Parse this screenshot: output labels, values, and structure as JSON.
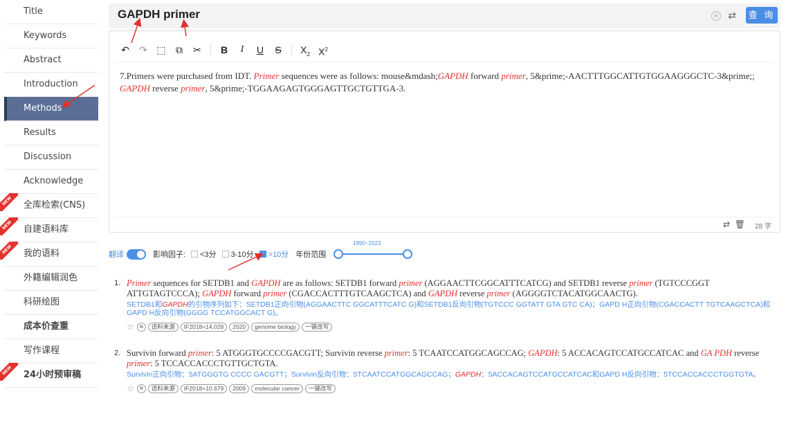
{
  "sidebar": {
    "items": [
      {
        "label": "Title",
        "active": false,
        "bold": false,
        "new": false
      },
      {
        "label": "Keywords",
        "active": false,
        "bold": false,
        "new": false
      },
      {
        "label": "Abstract",
        "active": false,
        "bold": false,
        "new": false
      },
      {
        "label": "Introduction",
        "active": false,
        "bold": false,
        "new": false
      },
      {
        "label": "Methods",
        "active": true,
        "bold": false,
        "new": false
      },
      {
        "label": "Results",
        "active": false,
        "bold": false,
        "new": false
      },
      {
        "label": "Discussion",
        "active": false,
        "bold": false,
        "new": false
      },
      {
        "label": "Acknowledge",
        "active": false,
        "bold": false,
        "new": false
      },
      {
        "label": "全库检索(CNS)",
        "active": false,
        "bold": false,
        "new": true
      },
      {
        "label": "自建语料库",
        "active": false,
        "bold": false,
        "new": true
      },
      {
        "label": "我的语料",
        "active": false,
        "bold": false,
        "new": true
      },
      {
        "label": "外籍编辑润色",
        "active": false,
        "bold": false,
        "new": false
      },
      {
        "label": "科研绘图",
        "active": false,
        "bold": false,
        "new": false
      },
      {
        "label": "成本价查重",
        "active": false,
        "bold": true,
        "new": false
      },
      {
        "label": "写作课程",
        "active": false,
        "bold": false,
        "new": false
      },
      {
        "label": "24小时预审稿",
        "active": false,
        "bold": true,
        "new": true
      }
    ],
    "new_badge": "NEW"
  },
  "search": {
    "query": "GAPDH primer",
    "button_label": "查 询",
    "clear_icon": "✕",
    "refresh_icon": "⇄"
  },
  "editor": {
    "toolbar_icons": [
      "undo-icon",
      "redo-icon",
      "select-all-icon",
      "copy-icon",
      "cut-icon",
      "bold-icon",
      "italic-icon",
      "underline-icon",
      "strikethrough-icon",
      "subscript-icon",
      "superscript-icon"
    ],
    "text_segments": [
      {
        "t": "7.Primers were purchased from IDT. ",
        "k": false
      },
      {
        "t": "Primer",
        "k": true
      },
      {
        "t": " sequences were as follows: mouse&mdash;",
        "k": false
      },
      {
        "t": "GAPDH",
        "k": true
      },
      {
        "t": " forward ",
        "k": false
      },
      {
        "t": "primer",
        "k": true
      },
      {
        "t": ", 5&prime;-AACTTTGGCATTGTGGAAGGGCTC-3&prime;; ",
        "k": false
      },
      {
        "t": "GAPDH",
        "k": true
      },
      {
        "t": " reverse ",
        "k": false
      },
      {
        "t": "primer",
        "k": true
      },
      {
        "t": ", 5&prime;-TGGAAGAGTGGGAGTTGCTGTTGA-3.",
        "k": false
      }
    ],
    "char_count": "28 字"
  },
  "filters": {
    "translate_label": "翻译",
    "translate_on": true,
    "impact_label": "影响因子:",
    "options": [
      {
        "label": "<3分",
        "checked": false
      },
      {
        "label": "3-10分",
        "checked": false
      },
      {
        "label": ">10分",
        "checked": true
      }
    ],
    "year_label": "年份范围",
    "year_range": "1990~2023"
  },
  "results": [
    {
      "num": "1.",
      "en": [
        {
          "t": "Primer",
          "k": true
        },
        {
          "t": " sequences for SETDB1 and ",
          "k": false
        },
        {
          "t": "GAPDH",
          "k": true
        },
        {
          "t": " are as follows: SETDB1 forward ",
          "k": false
        },
        {
          "t": "primer",
          "k": true
        },
        {
          "t": " (AGGAACTTCGGCATTTCATCG) and SETDB1 reverse ",
          "k": false
        },
        {
          "t": "primer",
          "k": true
        },
        {
          "t": " (TGTCCCGGT ATTGTAGTCCCA); ",
          "k": false
        },
        {
          "t": "GAPDH",
          "k": true
        },
        {
          "t": " forward ",
          "k": false
        },
        {
          "t": "primer",
          "k": true
        },
        {
          "t": " (CGACCACTTTGTCAAGCTCA) and ",
          "k": false
        },
        {
          "t": "GAPDH",
          "k": true
        },
        {
          "t": " reverse ",
          "k": false
        },
        {
          "t": "primer",
          "k": true
        },
        {
          "t": " (AGGGGTCTACATGGCAACTG).",
          "k": false
        }
      ],
      "cn": [
        {
          "t": "SETDB1和",
          "k": false
        },
        {
          "t": "GAPDH",
          "k": true
        },
        {
          "t": "的引物序列如下：SETDB1正向引物(AGGAACTTC GGCATTTCATC G)和SETDB1反向引物(TGTCCC GGTATT GTA GTC CA)；GAPD H正向引物(CGACCACTT TGTCAAGCTCA)和GAPD H反向引物(GGGG TCCATGGCACT G)。",
          "k": false
        }
      ],
      "tags": [
        "语料来源",
        "IF2018=14.028",
        "2020",
        "genome biology",
        "一键改写"
      ]
    },
    {
      "num": "2.",
      "en": [
        {
          "t": "Survivin forward ",
          "k": false
        },
        {
          "t": "primer",
          "k": true
        },
        {
          "t": ": 5 ATGGGTGCCCCGACGTT; Survivin reverse ",
          "k": false
        },
        {
          "t": "primer",
          "k": true
        },
        {
          "t": ": 5 TCAATCCATGGCAGCCAG; ",
          "k": false
        },
        {
          "t": "GAPDH",
          "k": true
        },
        {
          "t": ": 5 ACCACAGTCCATGCCATCAC and ",
          "k": false
        },
        {
          "t": "GA PDH",
          "k": true
        },
        {
          "t": " reverse ",
          "k": false
        },
        {
          "t": "primer",
          "k": true
        },
        {
          "t": ": 5 TCCACCACCCTGTTGCTGTA.",
          "k": false
        }
      ],
      "cn": [
        {
          "t": "Survivin正向引物：5ATGGGTG CCCC GACGTT；Survivin反向引物：5TCAATCCATGGCAGCCAG；",
          "k": false
        },
        {
          "t": "GAPDH",
          "k": true
        },
        {
          "t": "：5ACCACAGTCCATGCCATCAC和GAPD H反向引物：5TCCACCACCCTGGTGTA。",
          "k": false
        }
      ],
      "tags": [
        "语料来源",
        "IF2018=10.679",
        "2009",
        "molecular cancer",
        "一键改写"
      ]
    }
  ],
  "colors": {
    "accent": "#4a8fe7",
    "keyword": "#e0312c",
    "sidebar_active": "#5b6f96",
    "annotation_arrow": "#e0312c"
  }
}
